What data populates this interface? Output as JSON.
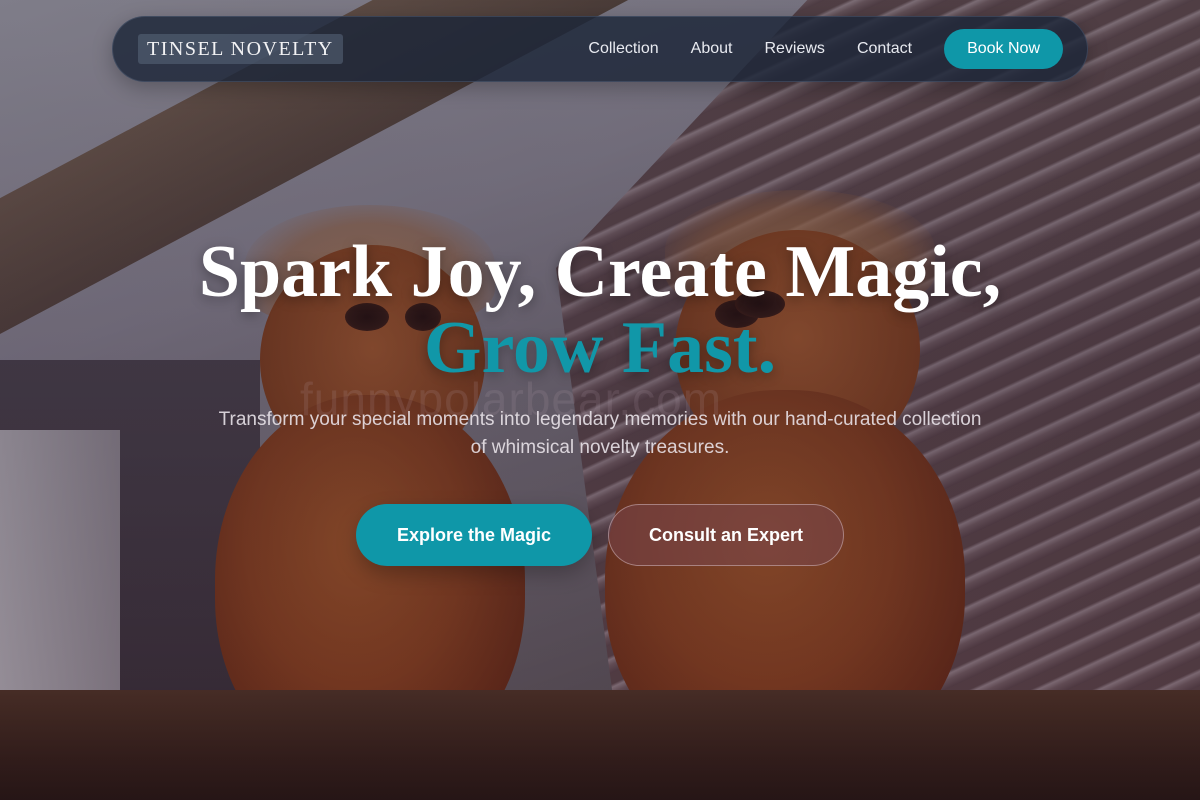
{
  "nav": {
    "logo": "TINSEL NOVELTY",
    "links": [
      "Collection",
      "About",
      "Reviews",
      "Contact"
    ],
    "cta": "Book Now"
  },
  "hero": {
    "headline_line1": "Spark Joy, Create Magic,",
    "headline_line2": "Grow Fast.",
    "subtitle": "Transform your special moments into legendary memories with our hand-curated collection of whimsical novelty treasures.",
    "primary_cta": "Explore the Magic",
    "secondary_cta": "Consult an Expert",
    "watermark": "funnypolarbear.com"
  },
  "colors": {
    "accent": "#0f97a8",
    "nav_bg": "#1c2638",
    "headline": "#ffffff"
  }
}
